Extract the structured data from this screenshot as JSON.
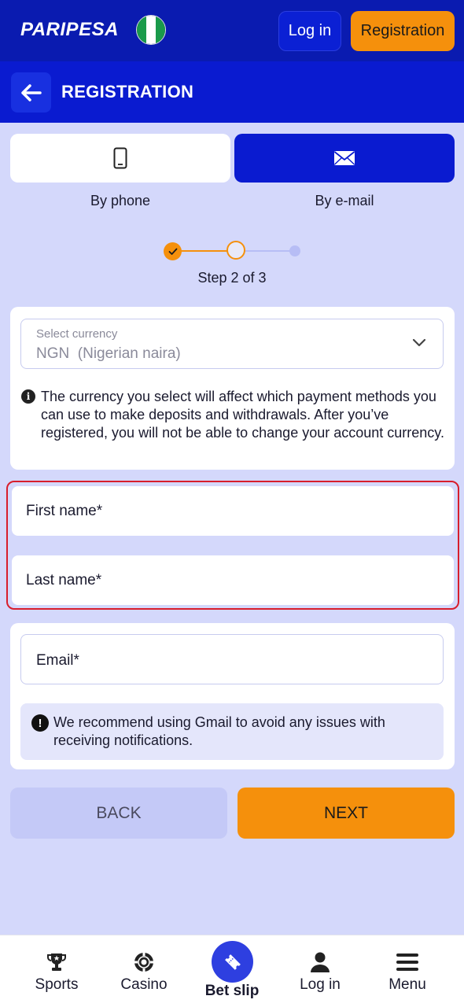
{
  "topbar": {
    "logo": "PARIPESA",
    "flag_icon": "nigeria-flag-icon",
    "login_label": "Log in",
    "registration_label": "Registration"
  },
  "header": {
    "back_icon": "arrow-left-icon",
    "title": "REGISTRATION"
  },
  "tabs": [
    {
      "icon": "phone-icon",
      "label": "By phone",
      "active": false
    },
    {
      "icon": "envelope-icon",
      "label": "By e-mail",
      "active": true
    }
  ],
  "stepper": {
    "current": 2,
    "total": 3,
    "text": "Step 2 of 3"
  },
  "currency": {
    "label": "Select currency",
    "value": "NGN  (Nigerian naira)",
    "info": "The currency you select will affect which payment methods you can use to make deposits and withdrawals. After you’ve registered, you will not be able to change your account currency."
  },
  "fields": {
    "first_name": "First name*",
    "last_name": "Last name*",
    "email": "Email*"
  },
  "email_notice": "We recommend using Gmail to avoid any issues with receiving notifications.",
  "buttons": {
    "back": "BACK",
    "next": "NEXT"
  },
  "bottom_nav": [
    {
      "icon": "trophy-icon",
      "label": "Sports"
    },
    {
      "icon": "casino-chip-icon",
      "label": "Casino"
    },
    {
      "icon": "ticket-icon",
      "label": "Bet slip"
    },
    {
      "icon": "user-icon",
      "label": "Log in"
    },
    {
      "icon": "hamburger-menu-icon",
      "label": "Menu"
    }
  ],
  "colors": {
    "primary_blue": "#0a1bd0",
    "accent_orange": "#f5900c",
    "background": "#d4d8fb",
    "highlight_red": "#d81e2c"
  }
}
